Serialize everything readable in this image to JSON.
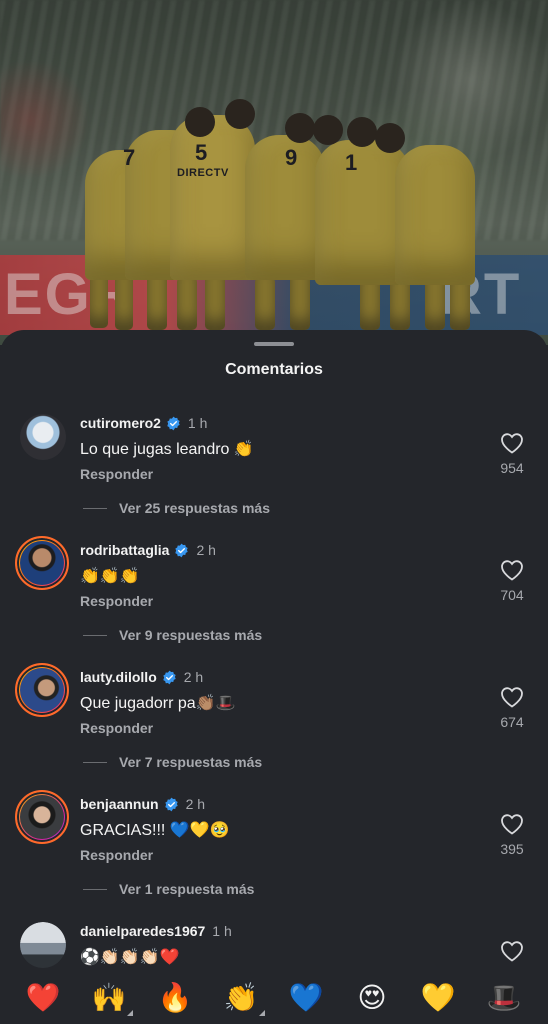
{
  "photo": {
    "board_text_left": "EGR",
    "board_text_right": "RT",
    "sponsor": "DIRECTV"
  },
  "sheet": {
    "title": "Comentarios"
  },
  "comments": [
    {
      "username": "cutiromero2",
      "time": "1 h",
      "text": "Lo que jugas leandro 👏",
      "reply": "Responder",
      "more": "Ver 25 respuestas más",
      "likes": "954"
    },
    {
      "username": "rodribattaglia",
      "time": "2 h",
      "text": "👏👏👏",
      "reply": "Responder",
      "more": "Ver 9 respuestas más",
      "likes": "704"
    },
    {
      "username": "lauty.dilollo",
      "time": "2 h",
      "text": "Que jugadorr pa👏🏽🎩",
      "reply": "Responder",
      "more": "Ver 7 respuestas más",
      "likes": "674"
    },
    {
      "username": "benjaannun",
      "time": "2 h",
      "text": "GRACIAS!!! 💙💛🥹",
      "reply": "Responder",
      "more": "Ver 1 respuesta más",
      "likes": "395"
    },
    {
      "username": "danielparedes1967",
      "time": "1 h",
      "text": "⚽👏🏻👏🏻👏🏻❤️",
      "reply": "",
      "more": "",
      "likes": ""
    }
  ],
  "emoji_bar": [
    "❤️",
    "🙌",
    "🔥",
    "👏",
    "💙",
    "😍",
    "💛",
    "🎩"
  ],
  "colors": {
    "sheet_bg": "#24262b",
    "verified": "#3897f0",
    "muted_text": "#a7a9ae"
  },
  "icons": {
    "verified": "verified-badge-icon",
    "like": "heart-outline-icon"
  }
}
